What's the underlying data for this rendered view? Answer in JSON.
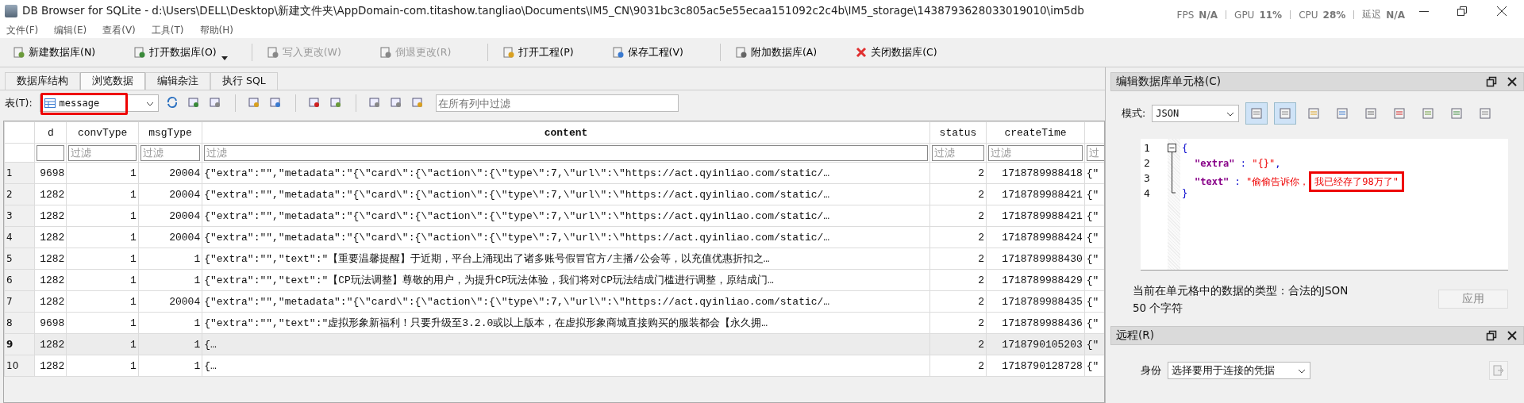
{
  "window": {
    "title": "DB Browser for SQLite - d:\\Users\\DELL\\Desktop\\新建文件夹\\AppDomain-com.titashow.tangliao\\Documents\\IM5_CN\\9031bc3c805ac5e55ecaa151092c2c4b\\IM5_storage\\1438793628033019010\\im5db"
  },
  "overlay_stats": [
    {
      "label": "FPS",
      "value": "N/A"
    },
    {
      "label": "GPU",
      "value": "11%"
    },
    {
      "label": "CPU",
      "value": "28%"
    },
    {
      "label": "延迟",
      "value": "N/A"
    }
  ],
  "menu": [
    "文件(F)",
    "编辑(E)",
    "查看(V)",
    "工具(T)",
    "帮助(H)"
  ],
  "toolbar": [
    {
      "kind": "button",
      "label": "新建数据库(N)",
      "disabled": false
    },
    {
      "kind": "button",
      "label": "打开数据库(O)",
      "disabled": false,
      "has_menu": true
    },
    {
      "kind": "separator"
    },
    {
      "kind": "button",
      "label": "写入更改(W)",
      "disabled": true
    },
    {
      "kind": "button",
      "label": "倒退更改(R)",
      "disabled": true
    },
    {
      "kind": "separator"
    },
    {
      "kind": "button",
      "label": "打开工程(P)",
      "disabled": false
    },
    {
      "kind": "button",
      "label": "保存工程(V)",
      "disabled": false
    },
    {
      "kind": "separator"
    },
    {
      "kind": "button",
      "label": "附加数据库(A)",
      "disabled": false
    },
    {
      "kind": "button",
      "label": "关闭数据库(C)",
      "disabled": false
    }
  ],
  "tabs": [
    {
      "label": "数据库结构",
      "selected": false
    },
    {
      "label": "浏览数据",
      "selected": true
    },
    {
      "label": "编辑杂注",
      "selected": false
    },
    {
      "label": "执行 SQL",
      "selected": false
    }
  ],
  "table_bar": {
    "label": "表(T):",
    "table": "message",
    "highlighted": true,
    "filter_placeholder": "在所有列中过滤"
  },
  "table": {
    "columns": [
      {
        "header": "d",
        "kind": "number",
        "bold": false
      },
      {
        "header": "convType",
        "filter_placeholder": "过滤",
        "kind": "number",
        "bold": false
      },
      {
        "header": "msgType",
        "filter_placeholder": "过滤",
        "kind": "number",
        "bold": false
      },
      {
        "header": "content",
        "filter_placeholder": "过滤",
        "kind": "text",
        "bold": true
      },
      {
        "header": "status",
        "filter_placeholder": "过滤",
        "kind": "number",
        "bold": false
      },
      {
        "header": "createTime",
        "filter_placeholder": "过滤",
        "kind": "number",
        "bold": false
      },
      {
        "filter_placeholder": "过",
        "kind": "text"
      }
    ],
    "rows": [
      {
        "number": "1",
        "selected": false,
        "cells": [
          "9698",
          "1",
          "20004",
          "{\"extra\":\"\",\"metadata\":\"{\\\"card\\\":{\\\"action\\\":{\\\"type\\\":7,\\\"url\\\":\\\"https://act.qyinliao.com/static/…",
          "2",
          "1718789988418",
          "{\""
        ]
      },
      {
        "number": "2",
        "selected": false,
        "cells": [
          "1282",
          "1",
          "20004",
          "{\"extra\":\"\",\"metadata\":\"{\\\"card\\\":{\\\"action\\\":{\\\"type\\\":7,\\\"url\\\":\\\"https://act.qyinliao.com/static/…",
          "2",
          "1718789988421",
          "{\""
        ]
      },
      {
        "number": "3",
        "selected": false,
        "cells": [
          "1282",
          "1",
          "20004",
          "{\"extra\":\"\",\"metadata\":\"{\\\"card\\\":{\\\"action\\\":{\\\"type\\\":7,\\\"url\\\":\\\"https://act.qyinliao.com/static/…",
          "2",
          "1718789988421",
          "{\""
        ]
      },
      {
        "number": "4",
        "selected": false,
        "cells": [
          "1282",
          "1",
          "20004",
          "{\"extra\":\"\",\"metadata\":\"{\\\"card\\\":{\\\"action\\\":{\\\"type\\\":7,\\\"url\\\":\\\"https://act.qyinliao.com/static/…",
          "2",
          "1718789988424",
          "{\""
        ]
      },
      {
        "number": "5",
        "selected": false,
        "cells": [
          "1282",
          "1",
          "1",
          "{\"extra\":\"\",\"text\":\"【重要温馨提醒】于近期，平台上涌现出了诸多账号假冒官方/主播/公会等，以充值优惠折扣之…",
          "2",
          "1718789988430",
          "{\""
        ]
      },
      {
        "number": "6",
        "selected": false,
        "cells": [
          "1282",
          "1",
          "1",
          "{\"extra\":\"\",\"text\":\"【CP玩法调整】尊敬的用户，为提升CP玩法体验，我们将对CP玩法结成门槛进行调整，原结成门…",
          "2",
          "1718789988429",
          "{\""
        ]
      },
      {
        "number": "7",
        "selected": false,
        "cells": [
          "1282",
          "1",
          "20004",
          "{\"extra\":\"\",\"metadata\":\"{\\\"card\\\":{\\\"action\\\":{\\\"type\\\":7,\\\"url\\\":\\\"https://act.qyinliao.com/static/…",
          "2",
          "1718789988435",
          "{\""
        ]
      },
      {
        "number": "8",
        "selected": false,
        "cells": [
          "9698",
          "1",
          "1",
          "{\"extra\":\"\",\"text\":\"虚拟形象新福利！只要升级至3.2.0或以上版本，在虚拟形象商城直接购买的服装都会【永久拥…",
          "2",
          "1718789988436",
          "{\""
        ]
      },
      {
        "number": "9",
        "selected": true,
        "cells": [
          "1282",
          "1",
          "1",
          "{…",
          "2",
          "1718790105203",
          "{\""
        ]
      },
      {
        "number": "10",
        "selected": false,
        "cells": [
          "1282",
          "1",
          "1",
          "{…",
          "2",
          "1718790128728",
          "{\""
        ]
      }
    ]
  },
  "cell_editor": {
    "title": "编辑数据库单元格(C)",
    "mode_label": "模式:",
    "mode": "JSON",
    "lines": [
      {
        "number": "1",
        "tokens": [
          {
            "kind": "brace",
            "text": "{"
          }
        ]
      },
      {
        "number": "2",
        "tokens": [
          {
            "kind": "key",
            "text": "\"extra\""
          },
          {
            "kind": "punct",
            "text": " : "
          },
          {
            "kind": "string",
            "text": "\"{}\""
          },
          {
            "kind": "punct",
            "text": ","
          }
        ]
      },
      {
        "number": "3",
        "tokens": [
          {
            "kind": "key",
            "text": "\"text\""
          },
          {
            "kind": "punct",
            "text": " : "
          },
          {
            "kind": "string",
            "text": "\"偷偷告诉你，"
          },
          {
            "kind": "string",
            "text": "我已经存了98万了\"",
            "highlighted": true
          }
        ]
      },
      {
        "number": "4",
        "tokens": [
          {
            "kind": "brace",
            "text": "}"
          }
        ]
      }
    ],
    "type_info": "当前在单元格中的数据的类型：合法的JSON",
    "char_count": "50 个字符",
    "apply_button": {
      "label": "应用",
      "disabled": true
    }
  },
  "remote": {
    "title": "远程(R)",
    "identity_label": "身份",
    "identity_value": "选择要用于连接的凭据"
  }
}
